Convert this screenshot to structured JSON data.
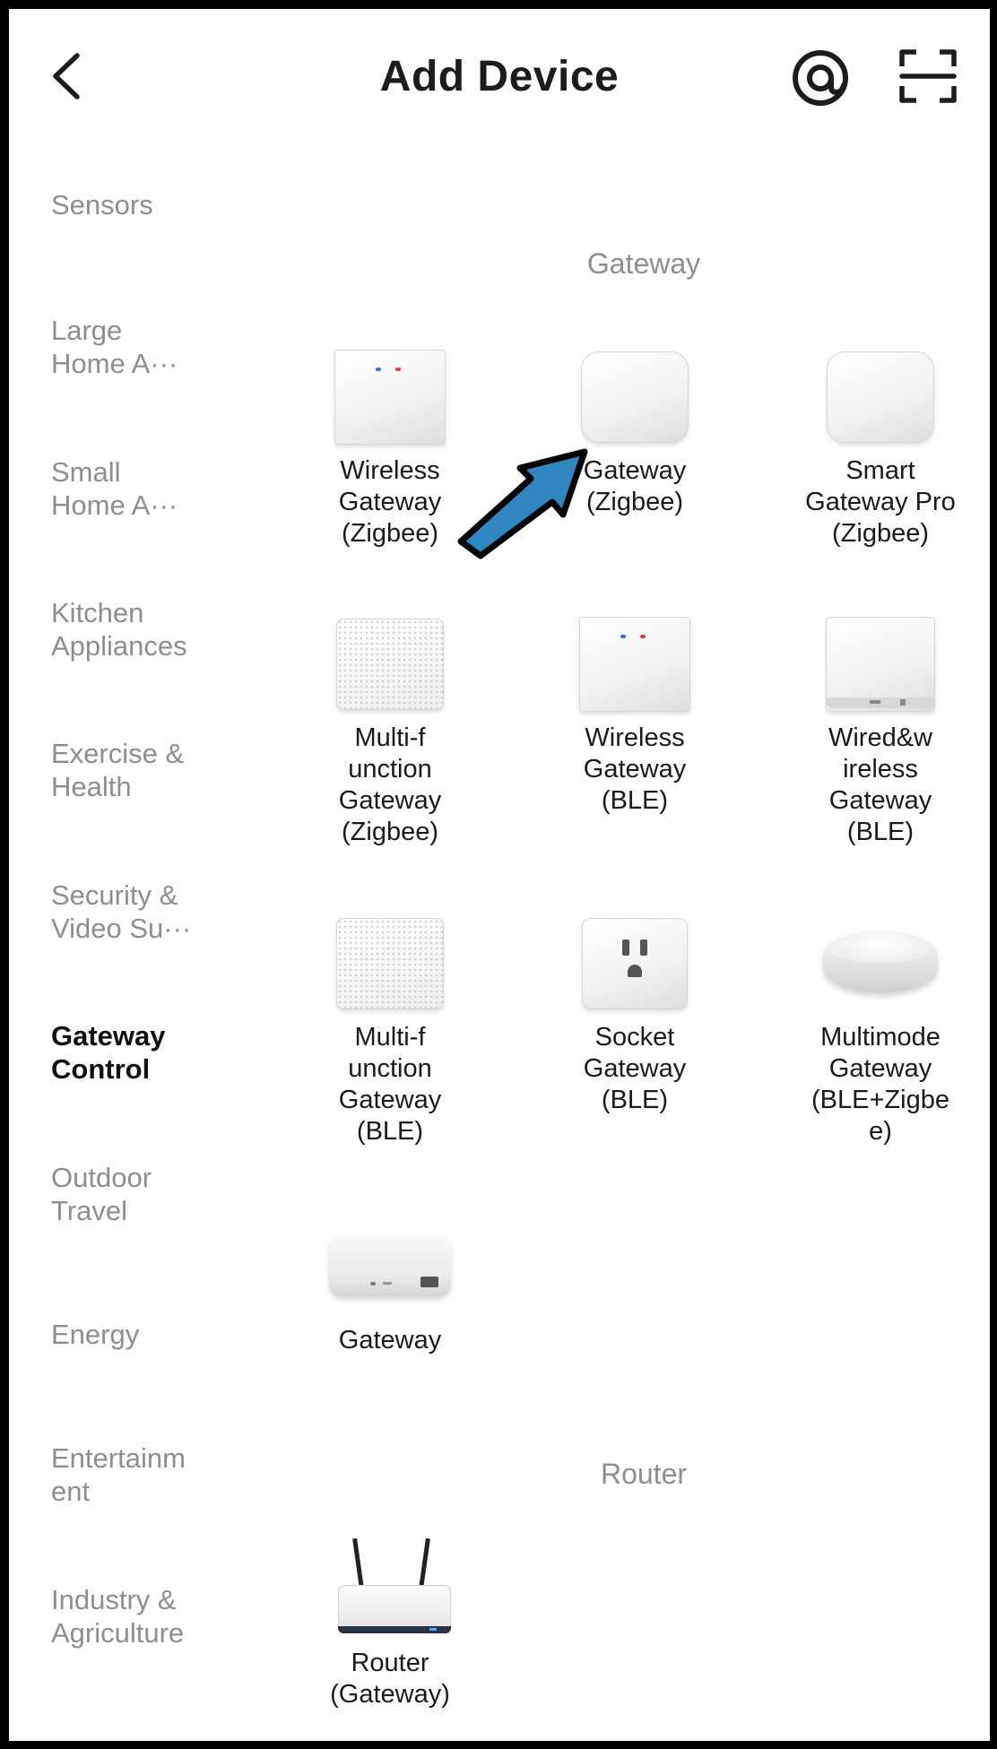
{
  "header": {
    "title": "Add Device",
    "back_icon": "chevron-left-icon",
    "right_icons": [
      "at-sign-icon",
      "scan-icon"
    ]
  },
  "sidebar": {
    "items": [
      {
        "label": "Sensors",
        "active": false
      },
      {
        "label": "Large\nHome A···",
        "active": false
      },
      {
        "label": "Small\nHome A···",
        "active": false
      },
      {
        "label": "Kitchen\nAppliances",
        "active": false
      },
      {
        "label": "Exercise &\nHealth",
        "active": false
      },
      {
        "label": "Security &\nVideo Su···",
        "active": false
      },
      {
        "label": "Gateway\nControl",
        "active": true
      },
      {
        "label": "Outdoor\nTravel",
        "active": false
      },
      {
        "label": "Energy",
        "active": false
      },
      {
        "label": "Entertainm\nent",
        "active": false
      },
      {
        "label": "Industry &\nAgriculture",
        "active": false
      }
    ]
  },
  "sections": [
    {
      "title": "Gateway",
      "devices": [
        {
          "label": "Wireless\nGateway\n(Zigbee)",
          "icon": "square-hub-with-dots"
        },
        {
          "label": "Gateway\n(Zigbee)",
          "icon": "rounded-hub"
        },
        {
          "label": "Smart\nGateway Pro\n(Zigbee)",
          "icon": "rounded-hub"
        },
        {
          "label": "Multi-f\nunction\nGateway\n(Zigbee)",
          "icon": "speaker-grille-hub"
        },
        {
          "label": "Wireless\nGateway\n(BLE)",
          "icon": "square-hub-with-dots"
        },
        {
          "label": "Wired&w\nireless\nGateway\n(BLE)",
          "icon": "hub-with-ports"
        },
        {
          "label": "Multi-f\nunction\nGateway\n(BLE)",
          "icon": "speaker-grille-hub"
        },
        {
          "label": "Socket\nGateway\n(BLE)",
          "icon": "plug-socket-hub"
        },
        {
          "label": "Multimode\nGateway\n(BLE+Zigbe\ne)",
          "icon": "round-puck-hub"
        },
        {
          "label": "Gateway",
          "icon": "flat-hub-with-ethernet"
        }
      ]
    },
    {
      "title": "Router",
      "devices": [
        {
          "label": "Router\n(Gateway)",
          "icon": "router-with-antennas"
        }
      ]
    }
  ],
  "overlay": {
    "icon": "blue-arrow-annotation-icon",
    "color": "#2f86c0"
  },
  "colors": {
    "active_text": "#111111",
    "inactive_text": "#8e8e8e",
    "background": "#ffffff",
    "frame": "#000000"
  }
}
